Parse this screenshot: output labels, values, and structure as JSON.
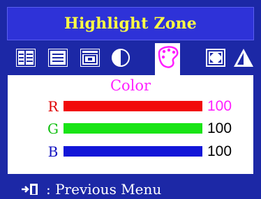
{
  "header": {
    "title": "Highlight Zone"
  },
  "menu_icons": [
    {
      "icon": "zone-split-icon",
      "selected": false
    },
    {
      "icon": "zone-page-icon",
      "selected": false
    },
    {
      "icon": "zone-window-icon",
      "selected": false
    },
    {
      "icon": "contrast-icon",
      "selected": false
    },
    {
      "icon": "color-palette-icon",
      "selected": true
    },
    {
      "icon": "size-position-icon",
      "selected": false
    },
    {
      "icon": "sharpness-icon",
      "selected": false
    }
  ],
  "panel": {
    "title": "Color",
    "channels": [
      {
        "letter": "R",
        "value": "100",
        "bar_color": "#f10b0b",
        "letter_color": "#e00000",
        "value_color": "#ff1fff",
        "level": 1.0
      },
      {
        "letter": "G",
        "value": "100",
        "bar_color": "#19e416",
        "letter_color": "#10c010",
        "value_color": "#000000",
        "level": 1.0
      },
      {
        "letter": "B",
        "value": "100",
        "bar_color": "#1216d8",
        "letter_color": "#1010c0",
        "value_color": "#000000",
        "level": 1.0
      }
    ]
  },
  "footer": {
    "exit_icon": "exit-door-icon",
    "label": ": Previous Menu"
  },
  "colors": {
    "background": "#1c28a6",
    "title_bar": "#2e32d8",
    "title_text": "#ffff44",
    "panel_title": "#ff1fff"
  }
}
